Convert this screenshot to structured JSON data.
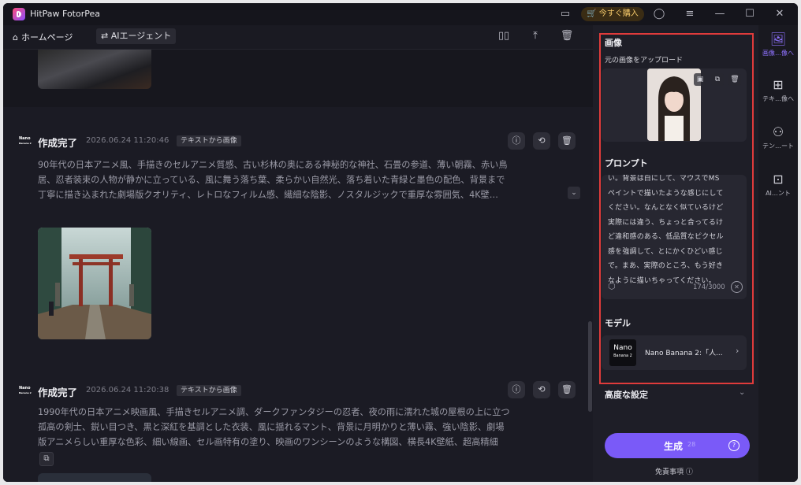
{
  "app": {
    "title": "HitPaw FotorPea",
    "buy_label": "今すぐ購入"
  },
  "topbar": {
    "home_label": "ホームページ",
    "agent_label": "AIエージェント"
  },
  "feed": {
    "entries": [
      {
        "status": "作成完了",
        "date": "2026.06.24  11:20:46",
        "tag": "テキストから画像",
        "logo_line1": "Nano",
        "logo_line2": "Banana 2",
        "prompt_lines": [
          "90年代の日本アニメ風、手描きのセルアニメ質感、古い杉林の奥にある神秘的な神社、石畳の参道、薄い朝霧、赤い鳥",
          "居、忍者装束の人物が静かに立っている、風に舞う落ち葉、柔らかい自然光、落ち着いた青緑と墨色の配色、背景まで",
          "丁寧に描き込まれた劇場版クオリティ、レトロなフィルム感、繊細な陰影、ノスタルジックで重厚な雰囲気、4K壁…"
        ]
      },
      {
        "status": "作成完了",
        "date": "2026.06.24  11:20:38",
        "tag": "テキストから画像",
        "logo_line1": "Nano",
        "logo_line2": "Banana 2",
        "prompt_lines": [
          "1990年代の日本アニメ映画風、手描きセルアニメ調、ダークファンタジーの忍者、夜の雨に濡れた城の屋根の上に立つ",
          "孤高の剣士、鋭い目つき、黒と深紅を基調とした衣装、風に揺れるマント、背景に月明かりと薄い霧、強い陰影、劇場",
          "版アニメらしい重厚な色彩、細い線画、セル画特有の塗り、映画のワンシーンのような構図、横長4K壁紙、超高精細"
        ]
      }
    ]
  },
  "panel": {
    "image_section": "画像",
    "upload_label": "元の画像をアップロード",
    "prompt_section": "プロンプト",
    "prompt_lines": [
      "い。背景は白にして、マウスでMS",
      "ペイントで描いたような感じにして",
      "ください。なんとなく似ているけど",
      "実際には違う、ちょっと合ってるけ",
      "ど違和感のある、低品質なピクセル",
      "感を強調して、とにかくひどい感じ",
      "で。まあ、実際のところ、もう好き",
      "なように描いちゃってください。"
    ],
    "char_count": "174/3000",
    "model_section": "モデル",
    "model_name": "Nano Banana 2:「人...",
    "model_logo_line1": "Nano",
    "model_logo_line2": "Banana 2",
    "advanced_label": "高度な設定",
    "generate_label": "生成",
    "generate_credit": "28",
    "disclaimer_label": "免責事項"
  },
  "rail": {
    "items": [
      {
        "label": "画像…像へ",
        "icon": "image-sparkle-icon",
        "active": true
      },
      {
        "label": "テキ…像へ",
        "icon": "text-image-icon",
        "active": false
      },
      {
        "label": "テン…ート",
        "icon": "template-icon",
        "active": false
      },
      {
        "label": "AI…ント",
        "icon": "ai-agent-icon",
        "active": false
      }
    ]
  },
  "colors": {
    "accent": "#7a5af8",
    "highlight_border": "#e03b3b",
    "buy": "#f5c96a"
  }
}
